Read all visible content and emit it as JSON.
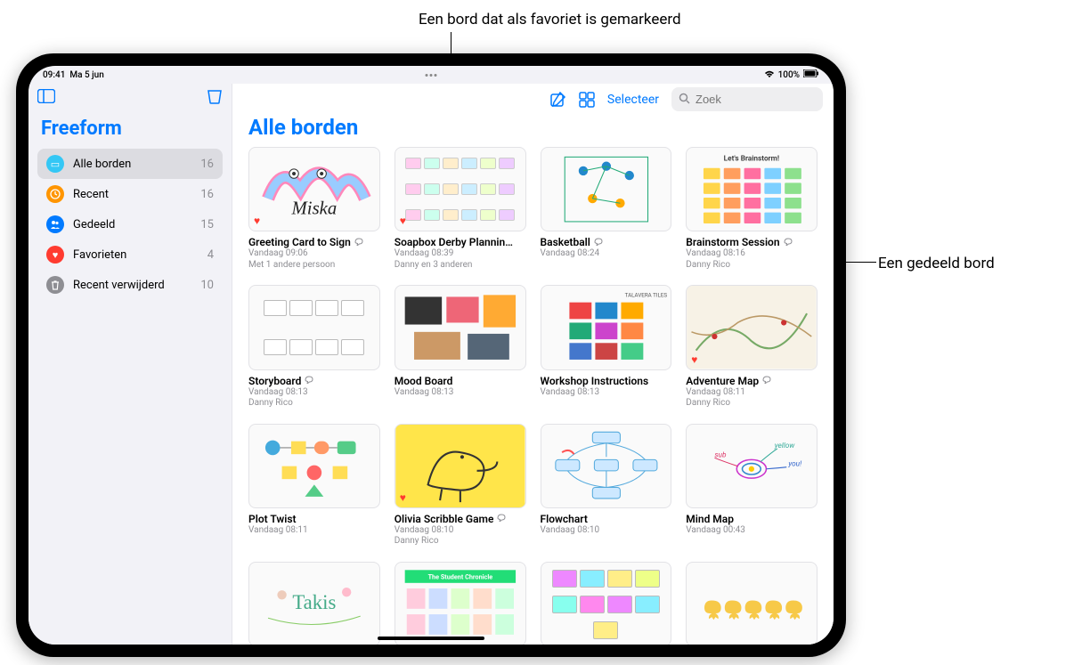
{
  "callouts": {
    "favorite": "Een bord dat als favoriet is gemarkeerd",
    "shared": "Een gedeeld bord"
  },
  "status": {
    "time": "09:41",
    "date": "Ma 5 jun",
    "battery": "100%"
  },
  "sidebar": {
    "app_title": "Freeform",
    "items": [
      {
        "label": "Alle borden",
        "count": "16",
        "iconColor": "#34c7f5",
        "glyph": "▭"
      },
      {
        "label": "Recent",
        "count": "16",
        "iconColor": "#ff9500",
        "glyph": "◴"
      },
      {
        "label": "Gedeeld",
        "count": "15",
        "iconColor": "#007aff",
        "glyph": "👥"
      },
      {
        "label": "Favorieten",
        "count": "4",
        "iconColor": "#ff3b30",
        "glyph": "♥"
      },
      {
        "label": "Recent verwijderd",
        "count": "10",
        "iconColor": "#8e8e93",
        "glyph": "🗑"
      }
    ]
  },
  "toolbar": {
    "select_label": "Selecteer"
  },
  "search": {
    "placeholder": "Zoek"
  },
  "content": {
    "title": "Alle borden"
  },
  "boards": [
    {
      "title": "Greeting Card to Sign",
      "shared": true,
      "favorite": true,
      "time": "Vandaag 09:06",
      "by": "Met 1 andere persoon",
      "style": "greeting"
    },
    {
      "title": "Soapbox Derby Plannin…",
      "shared": false,
      "favorite": true,
      "time": "Vandaag 08:39",
      "by": "Danny en 3 anderen",
      "style": "derby"
    },
    {
      "title": "Basketball",
      "shared": true,
      "favorite": false,
      "time": "Vandaag 08:24",
      "by": "",
      "style": "basketball"
    },
    {
      "title": "Brainstorm Session",
      "shared": true,
      "favorite": false,
      "time": "Vandaag 08:16",
      "by": "Danny Rico",
      "style": "brainstorm"
    },
    {
      "title": "Storyboard",
      "shared": true,
      "favorite": false,
      "time": "Vandaag 08:13",
      "by": "Danny Rico",
      "style": "storyboard"
    },
    {
      "title": "Mood Board",
      "shared": false,
      "favorite": false,
      "time": "Vandaag 08:13",
      "by": "",
      "style": "mood"
    },
    {
      "title": "Workshop Instructions",
      "shared": false,
      "favorite": false,
      "time": "Vandaag 08:13",
      "by": "",
      "style": "workshop"
    },
    {
      "title": "Adventure Map",
      "shared": true,
      "favorite": true,
      "time": "Vandaag 08:11",
      "by": "Danny Rico",
      "style": "adventure"
    },
    {
      "title": "Plot Twist",
      "shared": false,
      "favorite": false,
      "time": "Vandaag 08:11",
      "by": "",
      "style": "plot"
    },
    {
      "title": "Olivia Scribble Game",
      "shared": true,
      "favorite": true,
      "time": "Vandaag 08:10",
      "by": "Danny Rico",
      "style": "scribble"
    },
    {
      "title": "Flowchart",
      "shared": false,
      "favorite": false,
      "time": "Vandaag 08:10",
      "by": "",
      "style": "flowchart"
    },
    {
      "title": "Mind Map",
      "shared": false,
      "favorite": false,
      "time": "Vandaag 00:43",
      "by": "",
      "style": "mindmap"
    },
    {
      "title": "",
      "shared": false,
      "favorite": false,
      "time": "",
      "by": "",
      "style": "partial1"
    },
    {
      "title": "",
      "shared": false,
      "favorite": false,
      "time": "",
      "by": "",
      "style": "partial2"
    },
    {
      "title": "",
      "shared": false,
      "favorite": false,
      "time": "",
      "by": "",
      "style": "partial3"
    },
    {
      "title": "",
      "shared": false,
      "favorite": false,
      "time": "",
      "by": "",
      "style": "partial4"
    }
  ],
  "brainstorm_title": "Let's Brainstorm!",
  "partial2_title": "The Student Chronicle"
}
